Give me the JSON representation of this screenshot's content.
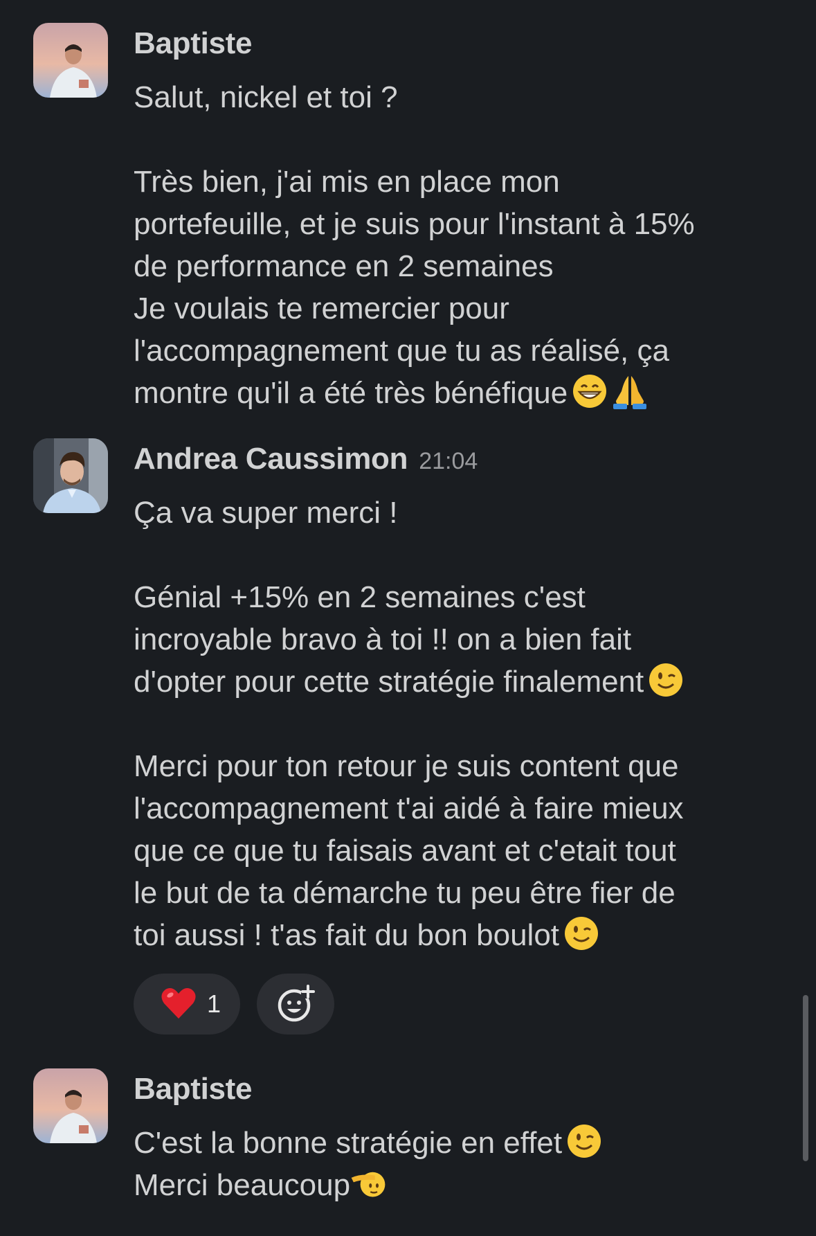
{
  "messages": [
    {
      "author": "Baptiste",
      "time": "",
      "lines": [
        "Salut, nickel et toi ?",
        "",
        "Très bien, j'ai mis en place mon",
        "portefeuille, et je suis pour l'instant à 15%",
        "de performance en 2 semaines",
        "Je voulais te remercier pour",
        "l'accompagnement que tu as réalisé, ça",
        "montre qu'il a été très bénéfique"
      ],
      "trailing_emojis": [
        "grinning-face",
        "folded-hands"
      ]
    },
    {
      "author": "Andrea Caussimon",
      "time": "21:04",
      "lines": [
        "Ça va super merci !",
        "",
        "Génial +15% en 2 semaines c'est",
        "incroyable bravo à toi !! on a bien fait",
        "d'opter pour cette stratégie finalement",
        "",
        "Merci pour ton retour je suis content que",
        "l'accompagnement t'ai aidé à faire mieux",
        "que ce que tu faisais avant et c'etait tout",
        "le but de ta démarche tu peu être fier de",
        "toi aussi ! t'as fait du bon boulot"
      ],
      "reactions": [
        {
          "emoji": "red-heart",
          "count": "1"
        }
      ]
    },
    {
      "author": "Baptiste",
      "time": "",
      "lines": [
        "C'est la bonne stratégie en effet",
        "Merci beaucoup"
      ]
    }
  ],
  "colors": {
    "background": "#1a1d21",
    "text": "#d1d2d3",
    "timestamp": "#9a9b9e",
    "reaction_bg": "#2c2e33"
  }
}
